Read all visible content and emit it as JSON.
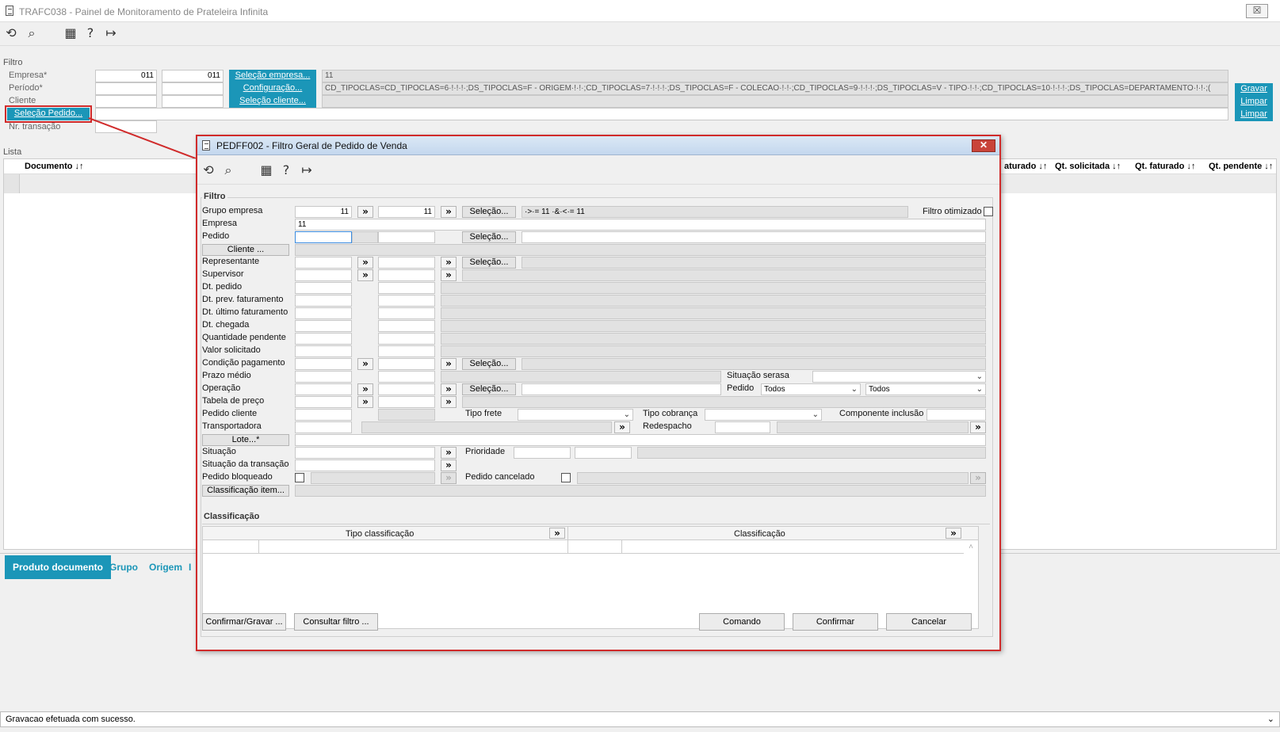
{
  "app": {
    "title": "TRAFC038 - Painel de Monitoramento de Prateleira Infinita",
    "close_glyph": "☒"
  },
  "toolbar": {
    "icons": [
      "refresh-icon",
      "search-icon",
      "calendar-icon",
      "help-icon",
      "exit-icon"
    ]
  },
  "filter": {
    "section_label": "Filtro",
    "empresa_label": "Empresa*",
    "periodo_label": "Período*",
    "cliente_label": "Cliente",
    "nr_transacao_label": "Nr. transação",
    "empresa_from": "011",
    "empresa_to": "011",
    "btn_selecao_empresa": "Seleção empresa...",
    "btn_configuracao": "Configuração...",
    "btn_selecao_cliente": "Seleção cliente...",
    "btn_selecao_pedido": "Seleção Pedido...",
    "empresa_result": "11",
    "config_result": "CD_TIPOCLAS=CD_TIPOCLAS=6·!·!·!·;DS_TIPOCLAS=F - ORIGEM·!·!·;CD_TIPOCLAS=7·!·!·!·;DS_TIPOCLAS=F - COLECAO·!·!·;CD_TIPOCLAS=9·!·!·!·;DS_TIPOCLAS=V - TIPO·!·!·;CD_TIPOCLAS=10·!·!·!·;DS_TIPOCLAS=DEPARTAMENTO·!·!·;(",
    "btn_gravar": "Gravar",
    "btn_limpar1": "Limpar",
    "btn_limpar2": "Limpar"
  },
  "list": {
    "section_label": "Lista",
    "col_documento": "Documento ↓↑",
    "col_faturado": "aturado ↓↑",
    "col_qt_solicitada": "Qt. solicitada ↓↑",
    "col_qt_faturado": "Qt. faturado ↓↑",
    "col_qt_pendente": "Qt. pendente ↓↑"
  },
  "tabs": [
    "Produto documento",
    "Grupo",
    "Origem",
    "I"
  ],
  "status_bar": {
    "message": "Gravacao efetuada com sucesso.",
    "dropdown_glyph": "⌄"
  },
  "dialog": {
    "title": "PEDFF002 - Filtro Geral de Pedido de Venda",
    "close_glyph": "✕",
    "filtro_label": "Filtro",
    "classificacao_label": "Classificação",
    "labels": {
      "grupo_empresa": "Grupo empresa",
      "empresa": "Empresa",
      "pedido": "Pedido",
      "cliente_btn": "Cliente ...",
      "representante": "Representante",
      "supervisor": "Supervisor",
      "dt_pedido": "Dt. pedido",
      "dt_prev_faturamento": "Dt. prev. faturamento",
      "dt_ultimo_faturamento": "Dt. último faturamento",
      "dt_chegada": "Dt. chegada",
      "quantidade_pendente": "Quantidade pendente",
      "valor_solicitado": "Valor solicitado",
      "condicao_pagamento": "Condição pagamento",
      "prazo_medio": "Prazo médio",
      "operacao": "Operação",
      "tabela_preco": "Tabela de preço",
      "pedido_cliente": "Pedido cliente",
      "transportadora": "Transportadora",
      "lote_btn": "Lote...*",
      "situacao": "Situação",
      "situacao_transacao": "Situação da transação",
      "pedido_bloqueado": "Pedido bloqueado",
      "classificacao_item_btn": "Classificação item...",
      "filtro_otimizado": "Filtro otimizado",
      "situacao_serasa": "Situação serasa",
      "tipo_frete": "Tipo frete",
      "tipo_cobranca": "Tipo cobrança",
      "componente_inclusao": "Componente inclusão",
      "redespacho": "Redespacho",
      "prioridade": "Prioridade",
      "pedido_cancelado": "Pedido cancelado"
    },
    "values": {
      "grupo_empresa_from": "11",
      "grupo_empresa_to": "11",
      "grupo_empresa_result": "·>·= 11 ·&·<·= 11",
      "empresa": "11",
      "pedido_select_1": "Todos",
      "pedido_select_2": "Todos"
    },
    "selecao_label": "Seleção...",
    "arrow_glyph": "»",
    "class_headers": {
      "tipo": "Tipo classificação",
      "classificacao": "Classificação"
    },
    "buttons": {
      "confirmar_gravar": "Confirmar/Gravar ...",
      "consultar_filtro": "Consultar filtro ...",
      "comando": "Comando",
      "confirmar": "Confirmar",
      "cancelar": "Cancelar"
    }
  }
}
